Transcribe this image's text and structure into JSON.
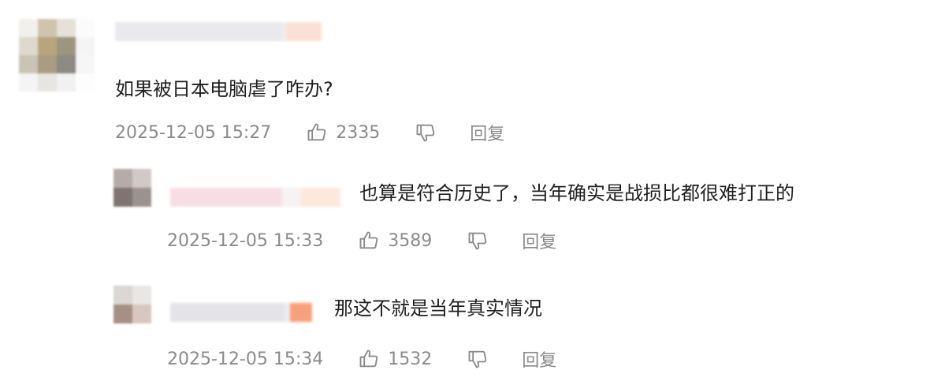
{
  "comments": [
    {
      "text": "如果被日本电脑虐了咋办?",
      "time": "2025-12-05 15:27",
      "likes": "2335",
      "reply_label": "回复",
      "avatar_colors": [
        "#f2f0ec",
        "#cfc4ae",
        "#e6e1d8",
        "#fbfbfb",
        "#ddd9cf",
        "#b9a57d",
        "#9c957f",
        "#f4f4f4",
        "#c9c4b6",
        "#a89c83",
        "#8d8a84",
        "#f6f6f6",
        "#f4f4f4",
        "#e7e5e1",
        "#f1f1f1",
        "#fdfdfd"
      ],
      "name_colors": [
        "#e9e9ee",
        "#ededf1",
        "#fbe1d4"
      ]
    },
    {
      "text": "也算是符合历史了，当年确实是战损比都很难打正的",
      "time": "2025-12-05 15:33",
      "likes": "3589",
      "reply_label": "回复",
      "avatar_colors": [
        "#b5aca8",
        "#d0cac7",
        "#7f7471",
        "#9b928f"
      ],
      "name_colors": [
        "#f9dde5",
        "#f7f2f3",
        "#fde8dc"
      ]
    },
    {
      "text": "那这不就是当年真实情况",
      "time": "2025-12-05 15:34",
      "likes": "1532",
      "reply_label": "回复",
      "avatar_colors": [
        "#dad7d4",
        "#e9e7e6",
        "#a68f85",
        "#d7c7c0"
      ],
      "name_colors": [
        "#e3e3e8",
        "#ececf0",
        "#f7a07b"
      ]
    }
  ],
  "icons": {
    "like": "thumbs-up-icon",
    "dislike": "thumbs-down-icon"
  },
  "colors": {
    "text": "#1f1f1f",
    "meta": "#8a8a8a"
  }
}
